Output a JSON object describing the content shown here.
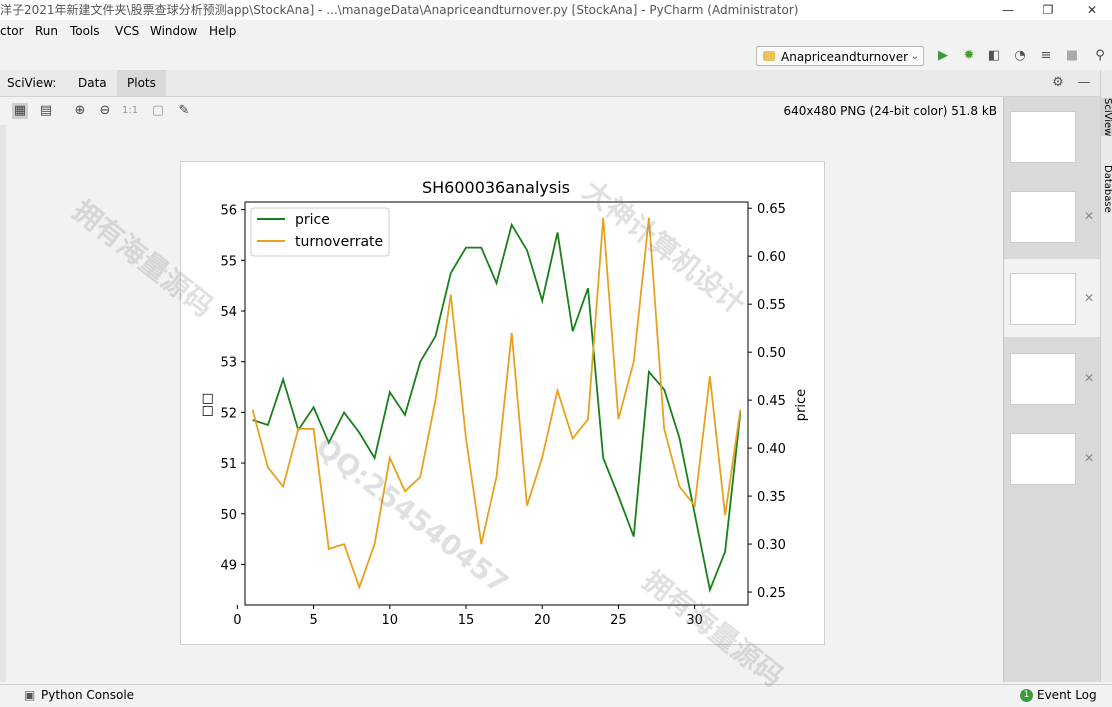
{
  "window": {
    "title": "洋子2021年新建文件夹\\股票查球分析预测app\\StockAna] - ...\\manageData\\Anapriceandturnover.py [StockAna] - PyCharm (Administrator)",
    "controls": [
      "—",
      "❐",
      "✕"
    ]
  },
  "menu": [
    "ctor",
    "Run",
    "Tools",
    "VCS",
    "Window",
    "Help"
  ],
  "toolbar": {
    "run_config": "Anapriceandturnover"
  },
  "sciview": {
    "label": "SciView:",
    "tabs": [
      "Data",
      "Plots"
    ],
    "active_tab": "Plots",
    "image_info": "640x480 PNG (24-bit color) 51.8 kB",
    "zoom_reset_label": "1:1"
  },
  "side_tabs": [
    "SciView",
    "Database"
  ],
  "status": {
    "left": "Python Console",
    "right": "Event Log",
    "event_count": "1"
  },
  "watermarks": [
    "拥有海量源码",
    "QQ:254540457",
    "大神计算机设计"
  ],
  "chart_data": {
    "type": "line",
    "title": "SH600036analysis",
    "ylabel_left": "□□",
    "ylabel_right": "price",
    "legend": "top-left",
    "x": [
      1,
      2,
      3,
      4,
      5,
      6,
      7,
      8,
      9,
      10,
      11,
      12,
      13,
      14,
      15,
      16,
      17,
      18,
      19,
      20,
      21,
      22,
      23,
      24,
      25,
      26,
      27,
      28,
      29,
      30,
      31,
      32,
      33
    ],
    "xlim": [
      0.5,
      33.5
    ],
    "xticks": [
      0,
      5,
      10,
      15,
      20,
      25,
      30
    ],
    "ylim_left": [
      48.2,
      56.15
    ],
    "yticks_left": [
      49,
      50,
      51,
      52,
      53,
      54,
      55,
      56
    ],
    "ylim_right": [
      0.2365,
      0.6565
    ],
    "yticks_right": [
      "0.25",
      "0.30",
      "0.35",
      "0.40",
      "0.45",
      "0.50",
      "0.55",
      "0.60",
      "0.65"
    ],
    "series": [
      {
        "name": "price",
        "axis": "left",
        "color": "#17801a",
        "values": [
          51.85,
          51.75,
          52.65,
          51.65,
          52.1,
          51.4,
          52.0,
          51.6,
          51.1,
          52.4,
          51.95,
          53.0,
          53.5,
          54.75,
          55.25,
          55.25,
          54.55,
          55.7,
          55.2,
          54.2,
          55.55,
          53.6,
          54.45,
          51.1,
          50.35,
          49.55,
          52.8,
          52.45,
          51.5,
          50.0,
          48.5,
          49.25,
          52.0
        ]
      },
      {
        "name": "turnoverrate",
        "axis": "right",
        "color": "#e6a21f",
        "values": [
          0.44,
          0.38,
          0.36,
          0.42,
          0.42,
          0.295,
          0.3,
          0.255,
          0.3,
          0.39,
          0.355,
          0.37,
          0.45,
          0.56,
          0.41,
          0.3,
          0.37,
          0.52,
          0.34,
          0.39,
          0.46,
          0.41,
          0.43,
          0.64,
          0.43,
          0.49,
          0.64,
          0.42,
          0.36,
          0.34,
          0.475,
          0.33,
          0.44
        ]
      }
    ]
  }
}
